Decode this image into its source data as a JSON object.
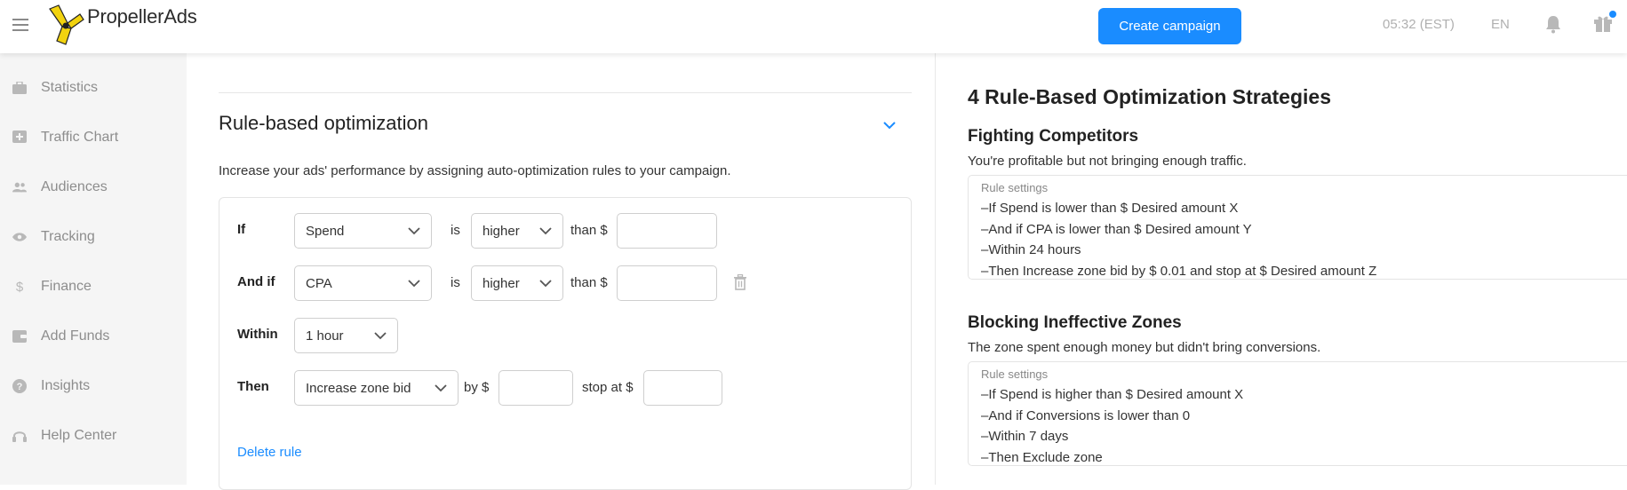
{
  "header": {
    "logo_text": "PropellerAds",
    "create_button": "Create campaign",
    "time": "05:32 (EST)",
    "language": "EN"
  },
  "sidebar": {
    "items": [
      {
        "label": "Statistics",
        "icon": "briefcase-icon"
      },
      {
        "label": "Traffic Chart",
        "icon": "chart-plus-icon"
      },
      {
        "label": "Audiences",
        "icon": "people-icon"
      },
      {
        "label": "Tracking",
        "icon": "eye-icon"
      },
      {
        "label": "Finance",
        "icon": "dollar-icon"
      },
      {
        "label": "Add Funds",
        "icon": "wallet-icon"
      },
      {
        "label": "Insights",
        "icon": "help-circle-icon"
      },
      {
        "label": "Help Center",
        "icon": "headset-icon"
      }
    ]
  },
  "main": {
    "title": "Rule-based optimization",
    "description": "Increase your ads' performance by assigning auto-optimization rules to your campaign.",
    "rule": {
      "if_label": "If",
      "if_metric": "Spend",
      "is_word": "is",
      "if_comparison": "higher",
      "than_word": "than $",
      "andif_label": "And if",
      "andif_metric": "CPA",
      "andif_comparison": "higher",
      "within_label": "Within",
      "within_value": "1 hour",
      "then_label": "Then",
      "then_action": "Increase zone bid",
      "by_word": "by $",
      "stopat_word": "stop at $",
      "delete_rule": "Delete rule"
    }
  },
  "right": {
    "title": "4 Rule-Based Optimization Strategies",
    "strategies": [
      {
        "name": "Fighting Competitors",
        "description": "You're profitable but not bringing enough traffic.",
        "settings_heading": "Rule settings",
        "lines": [
          "–If Spend is lower than $ Desired amount X",
          "–And if CPA is lower than $ Desired amount Y",
          "–Within 24 hours",
          "–Then Increase zone bid by $ 0.01 and stop at $ Desired amount Z"
        ]
      },
      {
        "name": "Blocking Ineffective Zones",
        "description": "The zone spent enough money but didn't bring conversions.",
        "settings_heading": "Rule settings",
        "lines": [
          "–If Spend is higher than $ Desired amount X",
          "–And if Conversions is lower than 0",
          "–Within 7 days",
          "–Then Exclude zone"
        ]
      }
    ]
  },
  "colors": {
    "accent": "#1a8cff",
    "sidebar_bg": "#f5f5f5",
    "logo_yellow": "#f2d30f"
  }
}
